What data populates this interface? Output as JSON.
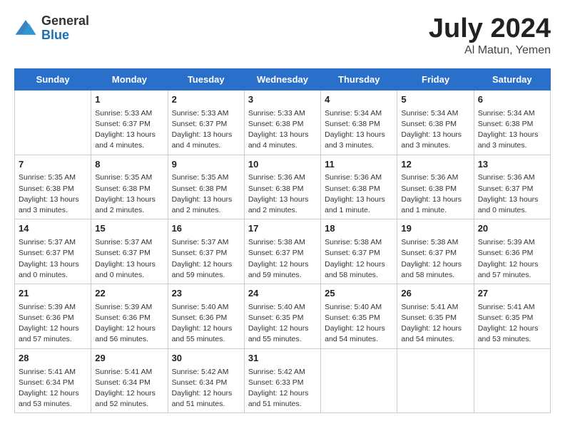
{
  "header": {
    "logo_general": "General",
    "logo_blue": "Blue",
    "title_month": "July 2024",
    "title_location": "Al Matun, Yemen"
  },
  "calendar": {
    "days_of_week": [
      "Sunday",
      "Monday",
      "Tuesday",
      "Wednesday",
      "Thursday",
      "Friday",
      "Saturday"
    ],
    "weeks": [
      [
        {
          "num": "",
          "info": ""
        },
        {
          "num": "1",
          "info": "Sunrise: 5:33 AM\nSunset: 6:37 PM\nDaylight: 13 hours\nand 4 minutes."
        },
        {
          "num": "2",
          "info": "Sunrise: 5:33 AM\nSunset: 6:37 PM\nDaylight: 13 hours\nand 4 minutes."
        },
        {
          "num": "3",
          "info": "Sunrise: 5:33 AM\nSunset: 6:38 PM\nDaylight: 13 hours\nand 4 minutes."
        },
        {
          "num": "4",
          "info": "Sunrise: 5:34 AM\nSunset: 6:38 PM\nDaylight: 13 hours\nand 3 minutes."
        },
        {
          "num": "5",
          "info": "Sunrise: 5:34 AM\nSunset: 6:38 PM\nDaylight: 13 hours\nand 3 minutes."
        },
        {
          "num": "6",
          "info": "Sunrise: 5:34 AM\nSunset: 6:38 PM\nDaylight: 13 hours\nand 3 minutes."
        }
      ],
      [
        {
          "num": "7",
          "info": "Sunrise: 5:35 AM\nSunset: 6:38 PM\nDaylight: 13 hours\nand 3 minutes."
        },
        {
          "num": "8",
          "info": "Sunrise: 5:35 AM\nSunset: 6:38 PM\nDaylight: 13 hours\nand 2 minutes."
        },
        {
          "num": "9",
          "info": "Sunrise: 5:35 AM\nSunset: 6:38 PM\nDaylight: 13 hours\nand 2 minutes."
        },
        {
          "num": "10",
          "info": "Sunrise: 5:36 AM\nSunset: 6:38 PM\nDaylight: 13 hours\nand 2 minutes."
        },
        {
          "num": "11",
          "info": "Sunrise: 5:36 AM\nSunset: 6:38 PM\nDaylight: 13 hours\nand 1 minute."
        },
        {
          "num": "12",
          "info": "Sunrise: 5:36 AM\nSunset: 6:38 PM\nDaylight: 13 hours\nand 1 minute."
        },
        {
          "num": "13",
          "info": "Sunrise: 5:36 AM\nSunset: 6:37 PM\nDaylight: 13 hours\nand 0 minutes."
        }
      ],
      [
        {
          "num": "14",
          "info": "Sunrise: 5:37 AM\nSunset: 6:37 PM\nDaylight: 13 hours\nand 0 minutes."
        },
        {
          "num": "15",
          "info": "Sunrise: 5:37 AM\nSunset: 6:37 PM\nDaylight: 13 hours\nand 0 minutes."
        },
        {
          "num": "16",
          "info": "Sunrise: 5:37 AM\nSunset: 6:37 PM\nDaylight: 12 hours\nand 59 minutes."
        },
        {
          "num": "17",
          "info": "Sunrise: 5:38 AM\nSunset: 6:37 PM\nDaylight: 12 hours\nand 59 minutes."
        },
        {
          "num": "18",
          "info": "Sunrise: 5:38 AM\nSunset: 6:37 PM\nDaylight: 12 hours\nand 58 minutes."
        },
        {
          "num": "19",
          "info": "Sunrise: 5:38 AM\nSunset: 6:37 PM\nDaylight: 12 hours\nand 58 minutes."
        },
        {
          "num": "20",
          "info": "Sunrise: 5:39 AM\nSunset: 6:36 PM\nDaylight: 12 hours\nand 57 minutes."
        }
      ],
      [
        {
          "num": "21",
          "info": "Sunrise: 5:39 AM\nSunset: 6:36 PM\nDaylight: 12 hours\nand 57 minutes."
        },
        {
          "num": "22",
          "info": "Sunrise: 5:39 AM\nSunset: 6:36 PM\nDaylight: 12 hours\nand 56 minutes."
        },
        {
          "num": "23",
          "info": "Sunrise: 5:40 AM\nSunset: 6:36 PM\nDaylight: 12 hours\nand 55 minutes."
        },
        {
          "num": "24",
          "info": "Sunrise: 5:40 AM\nSunset: 6:35 PM\nDaylight: 12 hours\nand 55 minutes."
        },
        {
          "num": "25",
          "info": "Sunrise: 5:40 AM\nSunset: 6:35 PM\nDaylight: 12 hours\nand 54 minutes."
        },
        {
          "num": "26",
          "info": "Sunrise: 5:41 AM\nSunset: 6:35 PM\nDaylight: 12 hours\nand 54 minutes."
        },
        {
          "num": "27",
          "info": "Sunrise: 5:41 AM\nSunset: 6:35 PM\nDaylight: 12 hours\nand 53 minutes."
        }
      ],
      [
        {
          "num": "28",
          "info": "Sunrise: 5:41 AM\nSunset: 6:34 PM\nDaylight: 12 hours\nand 53 minutes."
        },
        {
          "num": "29",
          "info": "Sunrise: 5:41 AM\nSunset: 6:34 PM\nDaylight: 12 hours\nand 52 minutes."
        },
        {
          "num": "30",
          "info": "Sunrise: 5:42 AM\nSunset: 6:34 PM\nDaylight: 12 hours\nand 51 minutes."
        },
        {
          "num": "31",
          "info": "Sunrise: 5:42 AM\nSunset: 6:33 PM\nDaylight: 12 hours\nand 51 minutes."
        },
        {
          "num": "",
          "info": ""
        },
        {
          "num": "",
          "info": ""
        },
        {
          "num": "",
          "info": ""
        }
      ]
    ]
  }
}
